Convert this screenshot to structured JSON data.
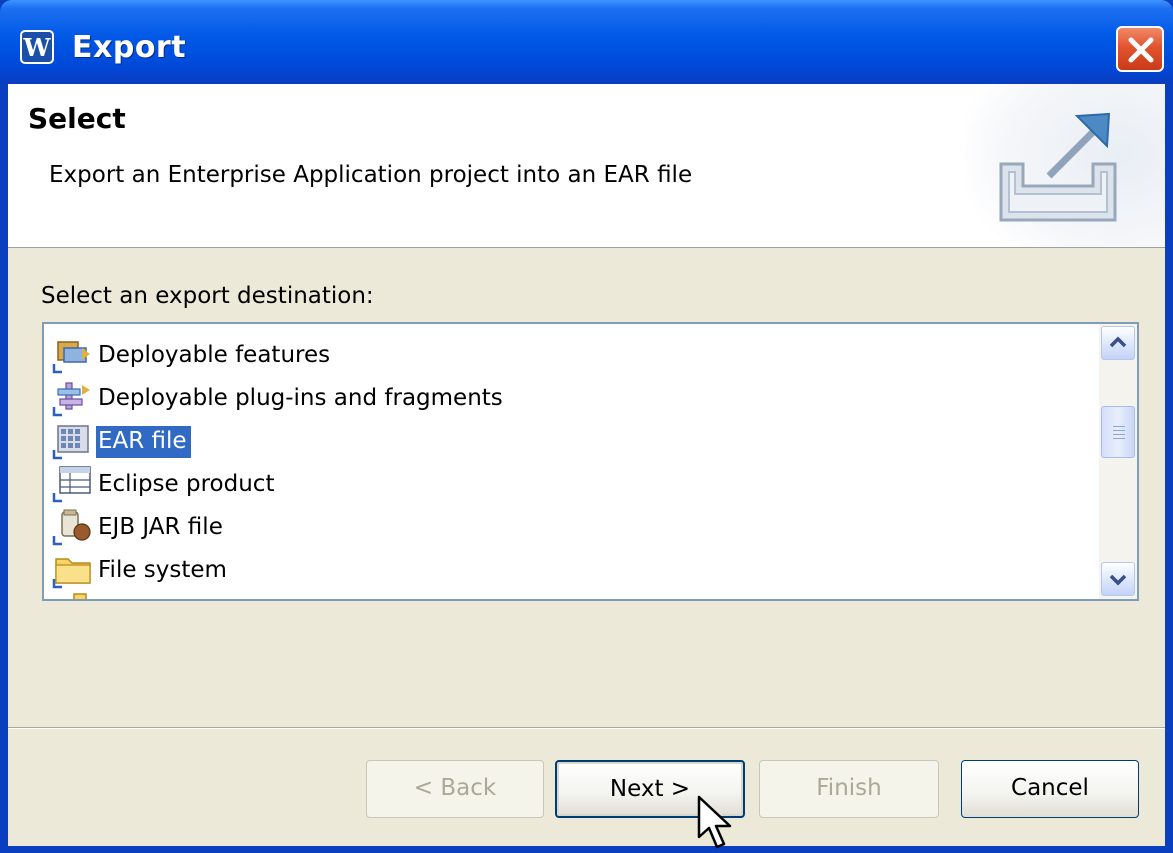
{
  "window": {
    "title": "Export"
  },
  "header": {
    "title": "Select",
    "description": "Export an Enterprise Application project into an EAR file"
  },
  "destination": {
    "label": "Select an export destination:",
    "items": [
      {
        "label": "Deployable features",
        "icon": "features-icon",
        "selected": false
      },
      {
        "label": "Deployable plug-ins and fragments",
        "icon": "plugins-icon",
        "selected": false
      },
      {
        "label": "EAR file",
        "icon": "ear-file-icon",
        "selected": true
      },
      {
        "label": "Eclipse product",
        "icon": "product-icon",
        "selected": false
      },
      {
        "label": "EJB JAR file",
        "icon": "ejb-jar-icon",
        "selected": false
      },
      {
        "label": "File system",
        "icon": "folder-icon",
        "selected": false
      }
    ]
  },
  "buttons": {
    "back": "< Back",
    "next": "Next >",
    "finish": "Finish",
    "cancel": "Cancel"
  },
  "colors": {
    "titlebar": "#0058e6",
    "selection": "#316ac5",
    "dialog_bg": "#ece9d8"
  }
}
